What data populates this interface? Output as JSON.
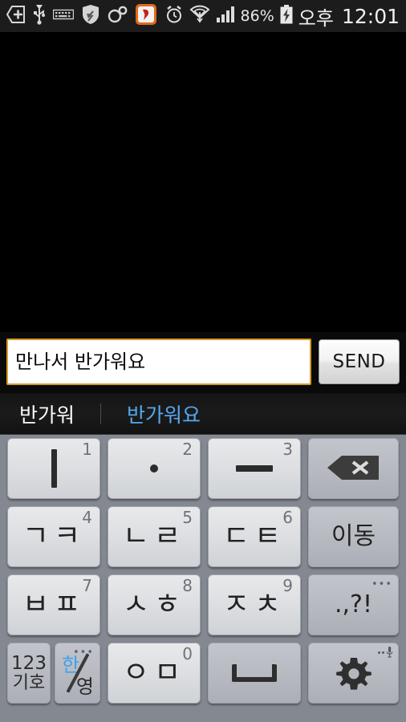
{
  "statusbar": {
    "icons_left": [
      "sd-card-icon",
      "usb-icon",
      "keyboard-icon",
      "shield-sync-icon",
      "sync-icon",
      "app-orange-icon"
    ],
    "icons_right": [
      "alarm-icon",
      "wifi-icon",
      "signal-icon"
    ],
    "battery_percent": "86%",
    "battery_icon": "battery-charging-icon",
    "ampm": "오후",
    "time": "12:01"
  },
  "input": {
    "value": "만나서 반가워요",
    "placeholder": "",
    "send_label": "SEND"
  },
  "suggestions": {
    "items": [
      {
        "text": "반가워",
        "selected": false
      },
      {
        "text": "반가워요",
        "selected": true
      }
    ],
    "selected_color": "#55a8f0",
    "normal_color": "#fafafa"
  },
  "keyboard": {
    "type": "korean-cheonjiin",
    "background": "#838891",
    "rows": [
      [
        {
          "label": "ㅣ",
          "glyph": "bar-vertical",
          "num": "1",
          "kind": "normal",
          "name": "key-i"
        },
        {
          "label": "·",
          "glyph": "dot",
          "num": "2",
          "kind": "normal",
          "name": "key-dot"
        },
        {
          "label": "ㅡ",
          "glyph": "bar-horizontal",
          "num": "3",
          "kind": "normal",
          "name": "key-eu"
        },
        {
          "label": "",
          "glyph": "backspace-icon",
          "num": "",
          "kind": "function",
          "name": "key-backspace"
        }
      ],
      [
        {
          "label": "ㄱㅋ",
          "glyph": "text",
          "num": "4",
          "kind": "normal",
          "name": "key-giyeok-kieuk"
        },
        {
          "label": "ㄴㄹ",
          "glyph": "text",
          "num": "5",
          "kind": "normal",
          "name": "key-nieun-rieul"
        },
        {
          "label": "ㄷㅌ",
          "glyph": "text",
          "num": "6",
          "kind": "normal",
          "name": "key-digeut-tieut"
        },
        {
          "label": "이동",
          "glyph": "text",
          "num": "",
          "kind": "function",
          "name": "key-move"
        }
      ],
      [
        {
          "label": "ㅂㅍ",
          "glyph": "text",
          "num": "7",
          "kind": "normal",
          "name": "key-bieup-pieup"
        },
        {
          "label": "ㅅㅎ",
          "glyph": "text",
          "num": "8",
          "kind": "normal",
          "name": "key-siot-hieut"
        },
        {
          "label": "ㅈㅊ",
          "glyph": "text",
          "num": "9",
          "kind": "normal",
          "name": "key-jieut-chieut"
        },
        {
          "label": ".,?!",
          "glyph": "text",
          "num": "",
          "kind": "function",
          "name": "key-punctuation",
          "dots": "•••"
        }
      ],
      [
        {
          "label_top": "123",
          "label_bottom": "기호",
          "kind": "function",
          "name": "key-symbols"
        },
        {
          "label_top": "한",
          "label_bottom": "영",
          "kind": "function",
          "name": "key-language-toggle",
          "dots": "•••"
        },
        {
          "label": "ㅇㅁ",
          "glyph": "text",
          "num": "0",
          "kind": "normal",
          "name": "key-ieung-mieum"
        },
        {
          "label": "",
          "glyph": "space-icon",
          "kind": "function",
          "name": "key-space"
        },
        {
          "label": "",
          "glyph": "gear-icon",
          "kind": "function",
          "name": "key-settings",
          "mic": "mic-icon"
        }
      ]
    ]
  }
}
